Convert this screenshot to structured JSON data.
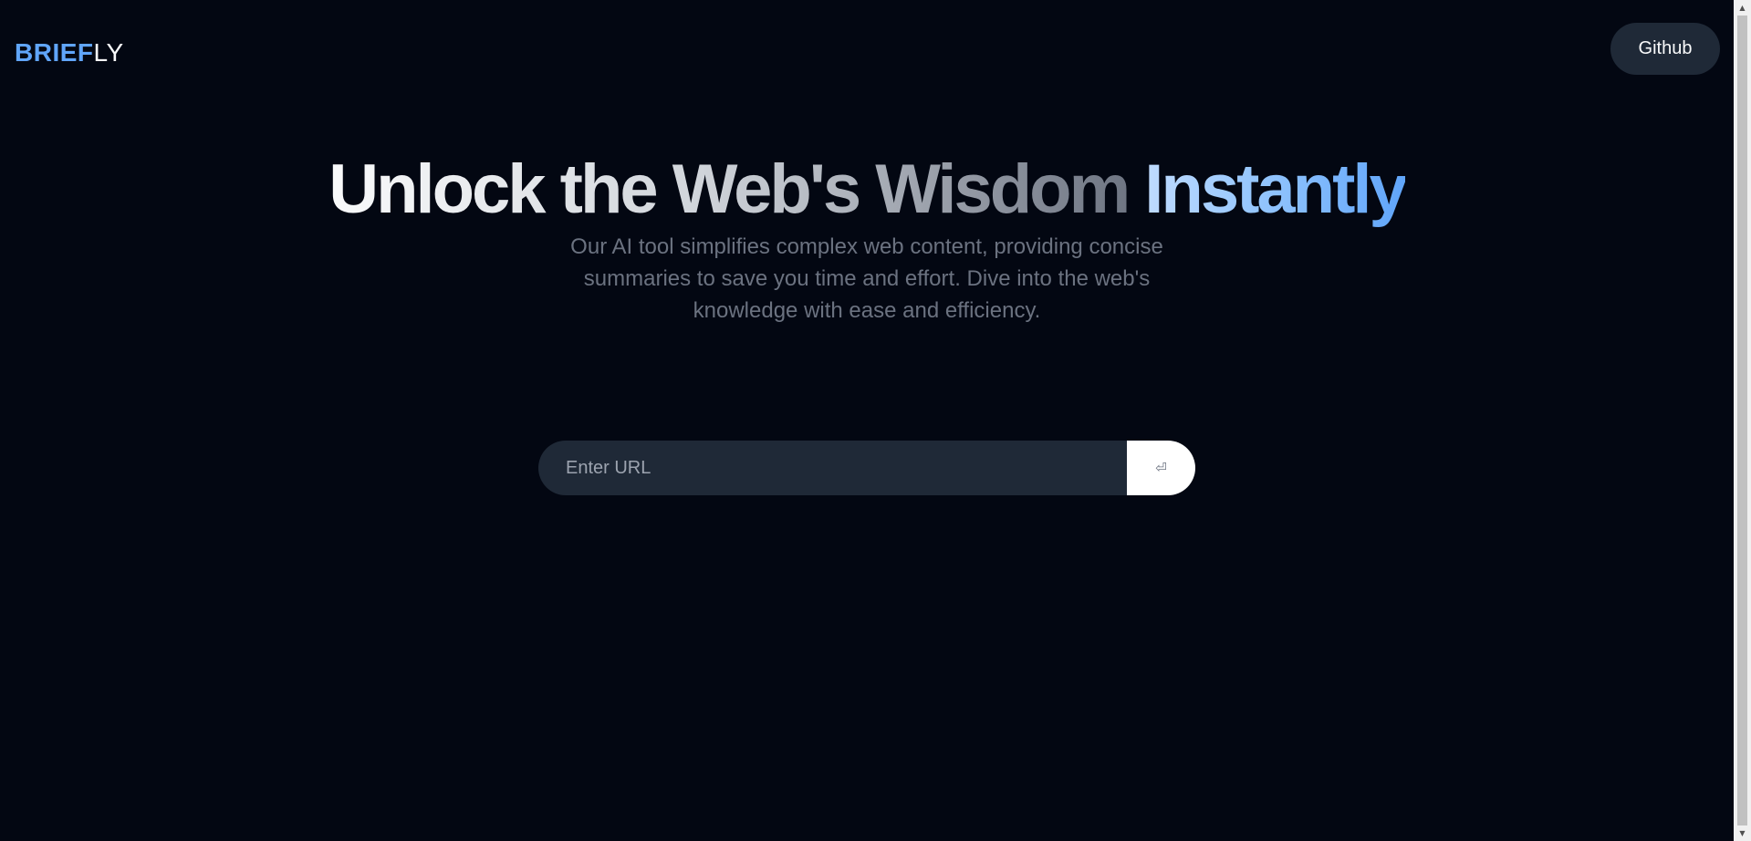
{
  "header": {
    "logo_accent": "BRIEF",
    "logo_rest": "LY",
    "github_label": "Github"
  },
  "hero": {
    "title_lead": "Unlock the Web's Wisdom ",
    "title_highlight": "Instantly",
    "subtitle": "Our AI tool simplifies complex web content, providing concise summaries to save you time and effort. Dive into the web's knowledge with ease and efficiency."
  },
  "search": {
    "placeholder": "Enter URL",
    "value": "",
    "submit_icon": "enter-icon",
    "submit_glyph": "⏎"
  },
  "scrollbar": {
    "up_glyph": "▲",
    "down_glyph": "▼"
  },
  "colors": {
    "background": "#030712",
    "accent": "#60a5fa",
    "button_dark": "#1f2937",
    "input_bg": "#1f2937",
    "subtitle": "#6b7280"
  }
}
